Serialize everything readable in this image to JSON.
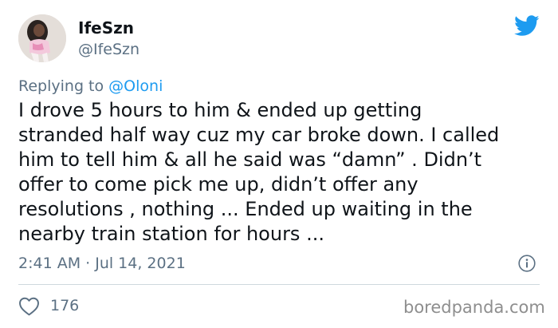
{
  "author": {
    "display_name": "IfeSzn",
    "handle": "@IfeSzn"
  },
  "reply": {
    "prefix": "Replying to",
    "target": "@Oloni"
  },
  "tweet": {
    "lines": [
      "I drove 5 hours to him & ended up getting",
      "stranded half way cuz my car broke down. I called",
      "him to tell him & all he said was “damn” . Didn’t",
      "offer to come pick me up, didn’t offer any",
      "resolutions , nothing ... Ended up waiting in the",
      "nearby train station for hours ..."
    ],
    "timestamp": "2:41 AM · Jul 14, 2021",
    "like_count": "176"
  },
  "watermark": "boredpanda.com",
  "icons": {
    "brand": "twitter-bird-icon",
    "info": "info-icon",
    "like": "heart-icon"
  },
  "colors": {
    "brand_blue": "#1d9bf0",
    "secondary_text": "#5b7083",
    "primary_text": "#0f1419",
    "divider": "#cfd9de",
    "watermark": "#8e8e8e"
  }
}
